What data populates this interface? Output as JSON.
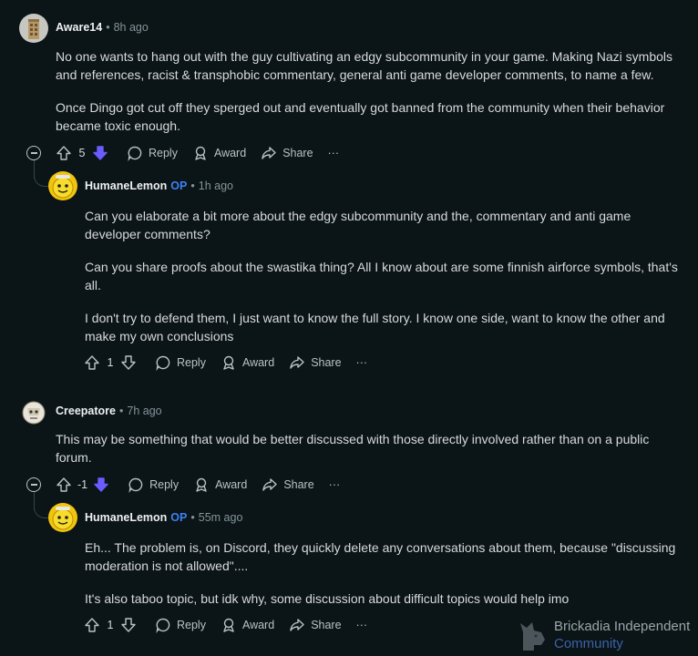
{
  "comments": [
    {
      "user": "Aware14",
      "op": "",
      "time": "8h ago",
      "paragraphs": [
        "No one wants to hang out with the guy cultivating an edgy subcommunity in your game. Making Nazi symbols and references, racist & transphobic commentary, general anti game developer comments, to name a few.",
        "Once Dingo got cut off they sperged out and eventually got banned from the community when their behavior became toxic enough."
      ],
      "score": "5",
      "downvoted": true
    },
    {
      "user": "HumaneLemon",
      "op": "OP",
      "time": "1h ago",
      "paragraphs": [
        "Can you elaborate a bit more about the edgy subcommunity and the, commentary and anti game developer comments?",
        "Can you share proofs about the swastika thing? All I know about are some finnish airforce symbols, that's all.",
        "I don't try to defend them, I just want to know the full story. I know one side, want to know the other and make my own conclusions"
      ],
      "score": "1",
      "downvoted": false
    },
    {
      "user": "Creepatore",
      "op": "",
      "time": "7h ago",
      "paragraphs": [
        "This may be something that would be better discussed with those directly involved rather than on a public forum."
      ],
      "score": "-1",
      "downvoted": true
    },
    {
      "user": "HumaneLemon",
      "op": "OP",
      "time": "55m ago",
      "paragraphs": [
        "Eh... The problem is, on Discord, they quickly delete any conversations about them, because \"discussing moderation is not allowed\"....",
        "It's also taboo topic, but idk why, some discussion about difficult topics would help imo"
      ],
      "score": "1",
      "downvoted": false
    }
  ],
  "actions": {
    "reply": "Reply",
    "award": "Award",
    "share": "Share",
    "more": "···"
  },
  "separator": "•",
  "watermark": {
    "line1": "Brickadia Independent",
    "line2": "Community"
  },
  "colors": {
    "background": "#0b1416",
    "downvote_active": "#6a5cff",
    "op": "#3b82f6",
    "thread_line": "#33464c"
  }
}
